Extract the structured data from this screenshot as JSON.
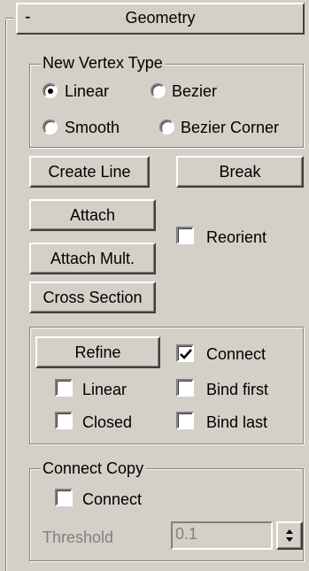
{
  "rollout": {
    "collapse_symbol": "-",
    "title": "Geometry"
  },
  "new_vertex_type": {
    "legend": "New Vertex Type",
    "options": [
      {
        "label": "Linear",
        "selected": true
      },
      {
        "label": "Bezier",
        "selected": false
      },
      {
        "label": "Smooth",
        "selected": false
      },
      {
        "label": "Bezier Corner",
        "selected": false
      }
    ]
  },
  "buttons": {
    "create_line": "Create Line",
    "break": "Break",
    "attach": "Attach",
    "attach_mult": "Attach Mult.",
    "cross_section": "Cross Section",
    "refine": "Refine"
  },
  "reorient": {
    "label": "Reorient",
    "checked": false
  },
  "refine_group": {
    "connect": {
      "label": "Connect",
      "checked": true
    },
    "linear": {
      "label": "Linear",
      "checked": false
    },
    "bind_first": {
      "label": "Bind first",
      "checked": false
    },
    "closed": {
      "label": "Closed",
      "checked": false
    },
    "bind_last": {
      "label": "Bind last",
      "checked": false
    }
  },
  "connect_copy": {
    "legend": "Connect Copy",
    "connect": {
      "label": "Connect",
      "checked": false
    },
    "threshold_label": "Threshold",
    "threshold_value": "0.1"
  }
}
